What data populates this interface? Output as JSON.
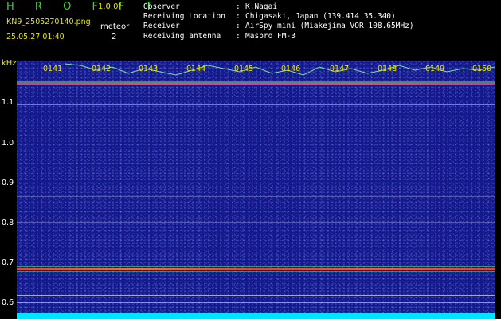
{
  "header": {
    "title": "H R O F F T",
    "version": "1.0.0f",
    "filename": "KN9_2505270140.png",
    "mode_label": "meteor",
    "datetime": "25.05.27 01:40",
    "mode_value": "2"
  },
  "info": [
    {
      "key": "Observer",
      "sep": ":",
      "value": "K.Nagai"
    },
    {
      "key": "Receiving Location",
      "sep": ":",
      "value": "Chigasaki, Japan (139.414 35.340)"
    },
    {
      "key": "Receiver",
      "sep": ":",
      "value": "AirSpy mini (Miakejima VOR 108.65MHz)"
    },
    {
      "key": "Receiving antenna",
      "sep": ":",
      "value": "Maspro FM-3"
    }
  ],
  "axis": {
    "unit": "kHz",
    "y_ticks": [
      "1.1",
      "1.0",
      "0.9",
      "0.8",
      "0.7",
      "0.6"
    ],
    "x_ticks": [
      "0141",
      "0142",
      "0143",
      "0144",
      "0145",
      "0146",
      "0147",
      "0148",
      "0149",
      "0150"
    ]
  },
  "colors": {
    "background": "#16198e",
    "signal": "#ff4040",
    "label": "#e8e800",
    "title": "#3fd23f",
    "baseline": "#00e5ff"
  }
}
